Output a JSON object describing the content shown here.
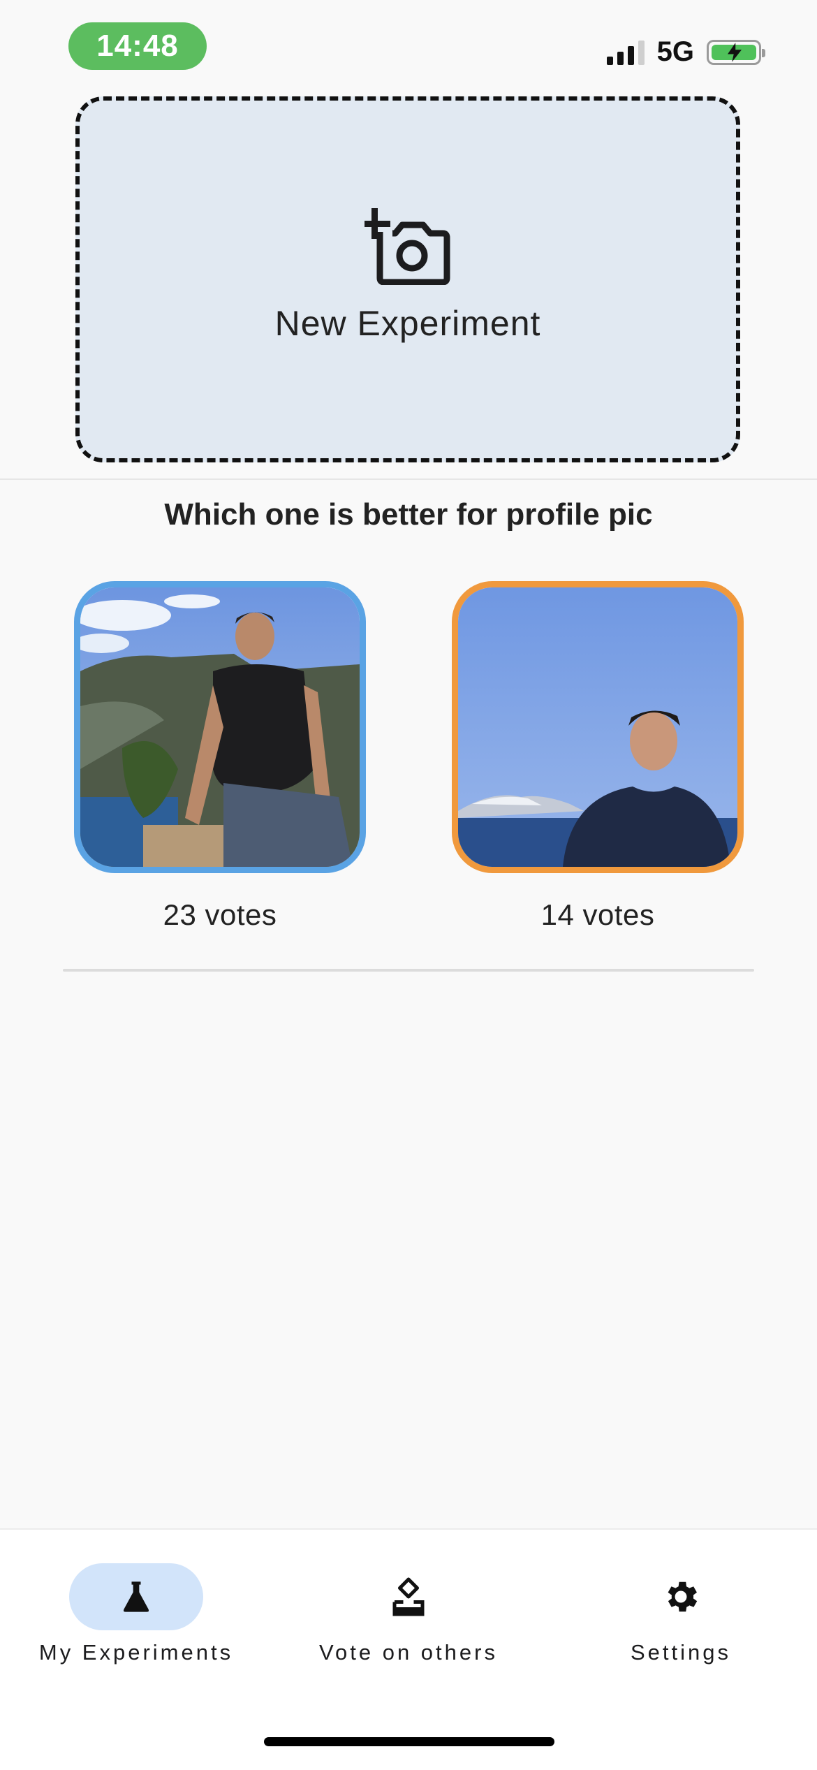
{
  "status_bar": {
    "time": "14:48",
    "network": "5G",
    "time_pill_color": "#5cbd5f",
    "battery_color": "#4fc15a",
    "battery_charging": true
  },
  "new_experiment": {
    "label": "New Experiment",
    "icon": "add-photo-icon",
    "background": "#e1e9f2"
  },
  "experiment": {
    "title": "Which one is better for profile pic",
    "options": [
      {
        "votes_text": "23 votes",
        "border_color": "#5aa3e4"
      },
      {
        "votes_text": "14 votes",
        "border_color": "#f0993d"
      }
    ]
  },
  "bottom_nav": {
    "items": [
      {
        "label": "My Experiments",
        "icon": "flask-icon",
        "active": true
      },
      {
        "label": "Vote on others",
        "icon": "ballot-box-icon",
        "active": false
      },
      {
        "label": "Settings",
        "icon": "gear-icon",
        "active": false
      }
    ],
    "active_highlight": "#d2e4fa"
  }
}
